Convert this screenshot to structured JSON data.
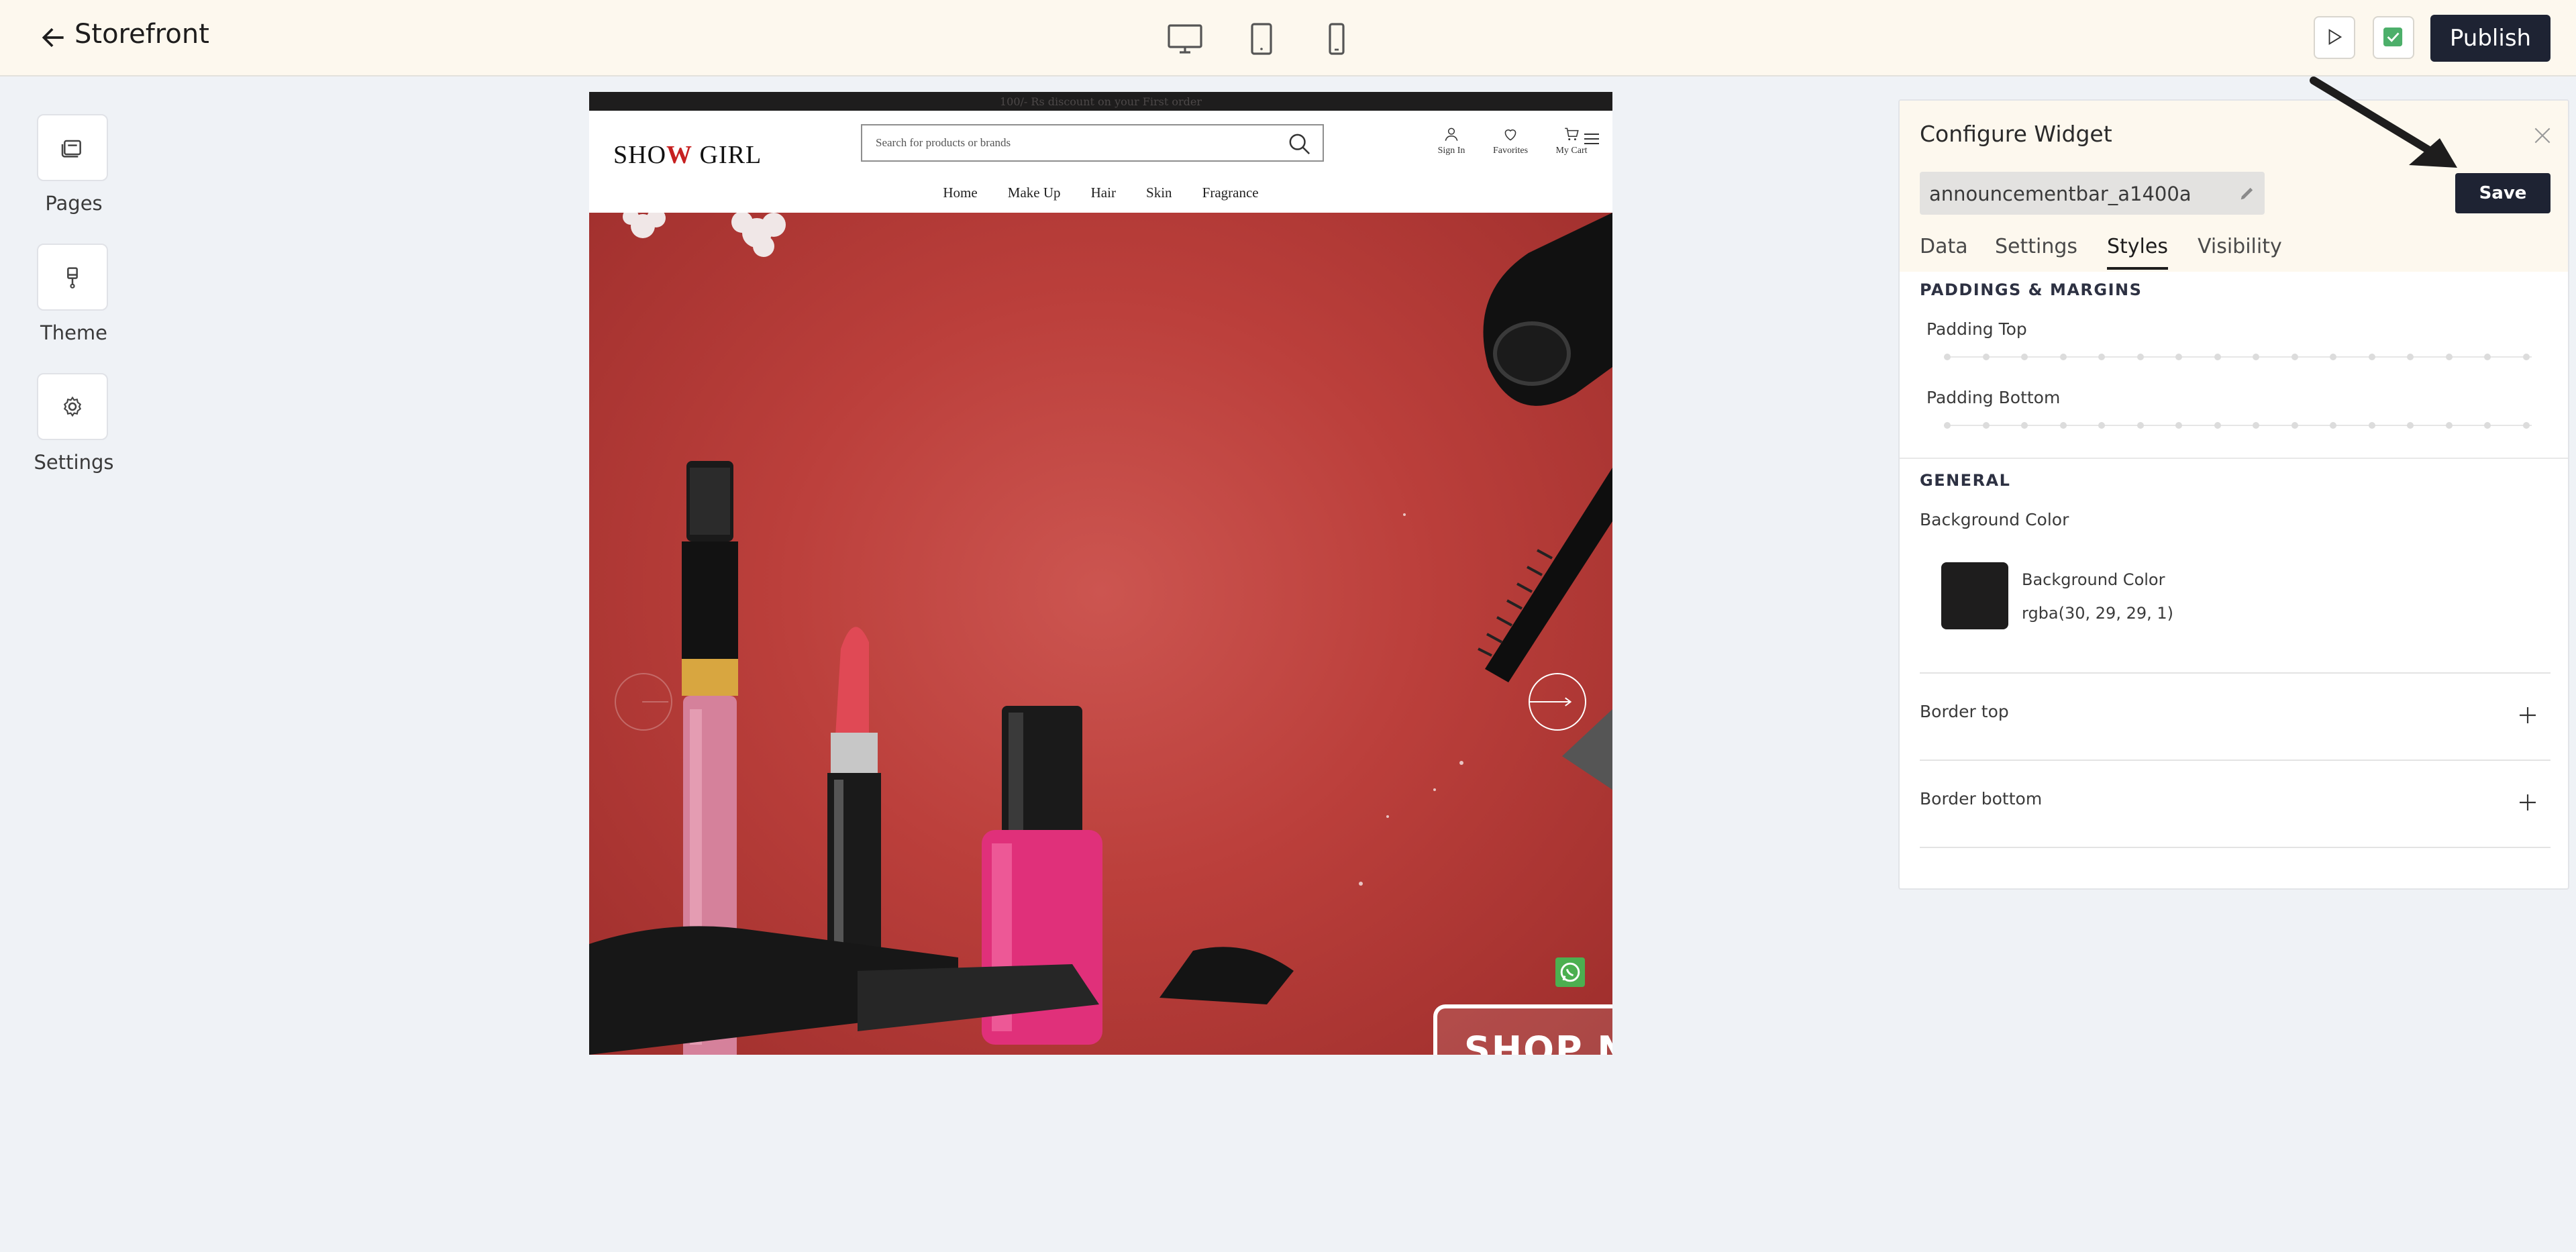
{
  "header": {
    "title": "Storefront",
    "publish_label": "Publish"
  },
  "sidebar": {
    "items": [
      {
        "label": "Pages",
        "icon": "pages-icon"
      },
      {
        "label": "Theme",
        "icon": "brush-icon"
      },
      {
        "label": "Settings",
        "icon": "gear-icon"
      }
    ]
  },
  "preview": {
    "announcement": "100/- Rs discount on your First order",
    "logo": {
      "left": "SHO",
      "mark": "W",
      "right": " GIRL"
    },
    "search_placeholder": "Search for products or brands",
    "account_links": [
      "Sign In",
      "Favorites",
      "My Cart"
    ],
    "nav": [
      "Home",
      "Make Up",
      "Hair",
      "Skin",
      "Fragrance"
    ],
    "hero_cta": "SHOP N"
  },
  "panel": {
    "title": "Configure Widget",
    "widget_id": "announcementbar_a1400a",
    "save_label": "Save",
    "tabs": [
      "Data",
      "Settings",
      "Styles",
      "Visibility"
    ],
    "active_tab": "Styles",
    "paddings_heading": "PADDINGS & MARGINS",
    "padding_top_label": "Padding Top",
    "padding_bottom_label": "Padding Bottom",
    "general_heading": "GENERAL",
    "bg_color_label": "Background Color",
    "bg_color_name": "Background Color",
    "bg_color_value": "rgba(30, 29, 29, 1)",
    "border_top_label": "Border top",
    "border_bottom_label": "Border bottom"
  },
  "colors": {
    "topbar_bg": "#fdf8ee",
    "dark_button": "#1e2333",
    "swatch": "#1e1d1d",
    "hero_red": "#bb3f3b"
  }
}
